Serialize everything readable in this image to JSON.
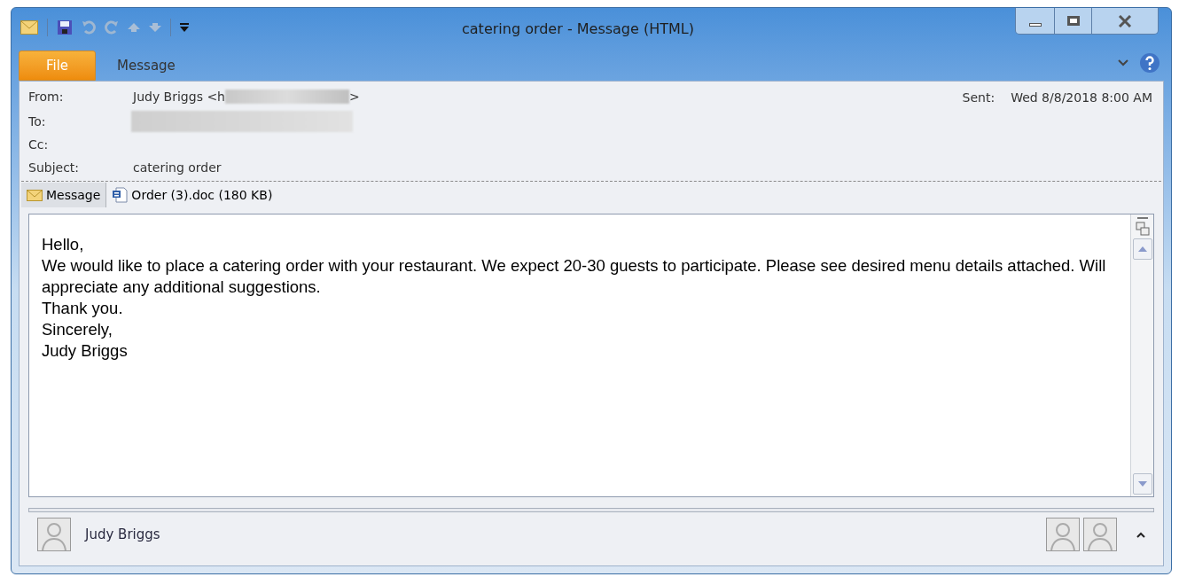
{
  "window": {
    "title": "catering order - Message (HTML)"
  },
  "ribbon_tabs": [
    {
      "label": "File",
      "selected": true
    },
    {
      "label": "Message",
      "selected": false
    }
  ],
  "header": {
    "from_label": "From:",
    "from_value": "Judy Briggs <h",
    "from_end": ">",
    "to_label": "To:",
    "cc_label": "Cc:",
    "subject_label": "Subject:",
    "subject_value": "catering order",
    "sent_label": "Sent:",
    "sent_value": "Wed 8/8/2018 8:00 AM"
  },
  "attachment_tabs": [
    {
      "label": "Message",
      "kind": "message",
      "selected": true
    },
    {
      "label": "Order (3).doc (180 KB)",
      "kind": "document",
      "selected": false
    }
  ],
  "body": [
    "Hello,",
    "We would like to place a catering order with your restaurant. We expect 20-30 guests to participate. Please see desired menu details attached. Will appreciate any additional suggestions.",
    "Thank you.",
    "Sincerely,",
    "Judy Briggs"
  ],
  "people_pane": {
    "name": "Judy Briggs"
  }
}
